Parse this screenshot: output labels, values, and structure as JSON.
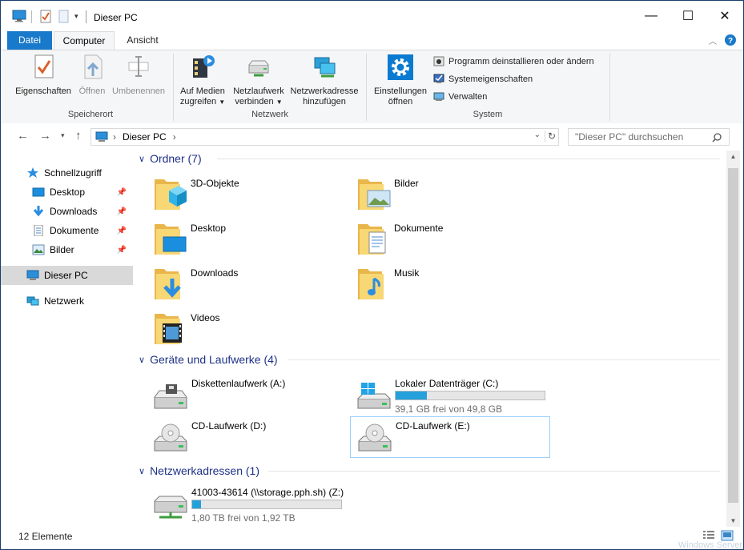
{
  "window": {
    "title": "Dieser PC"
  },
  "window_controls": {
    "minimize": "—",
    "maximize": "☐",
    "close": "✕"
  },
  "tabs": {
    "file": "Datei",
    "computer": "Computer",
    "view": "Ansicht"
  },
  "ribbon": {
    "properties": "Eigenschaften",
    "open": "Öffnen",
    "rename": "Umbenennen",
    "group_location": "Speicherort",
    "media_line1": "Auf Medien",
    "media_line2": "zugreifen",
    "netdrive_line1": "Netzlaufwerk",
    "netdrive_line2": "verbinden",
    "netloc_line1": "Netzwerkadresse",
    "netloc_line2": "hinzufügen",
    "group_network": "Netzwerk",
    "settings_line1": "Einstellungen",
    "settings_line2": "öffnen",
    "uninstall": "Programm deinstallieren oder ändern",
    "sysprops": "Systemeigenschaften",
    "manage": "Verwalten",
    "group_system": "System"
  },
  "address": {
    "crumb": "Dieser PC",
    "sep1": "›",
    "sep2": "›"
  },
  "search": {
    "placeholder": "\"Dieser PC\" durchsuchen"
  },
  "nav": {
    "quick_access": "Schnellzugriff",
    "desktop": "Desktop",
    "downloads": "Downloads",
    "documents": "Dokumente",
    "pictures": "Bilder",
    "this_pc": "Dieser PC",
    "network": "Netzwerk"
  },
  "groups": {
    "folders": "Ordner (7)",
    "devices": "Geräte und Laufwerke (4)",
    "netlocs": "Netzwerkadressen (1)"
  },
  "folders": [
    "3D-Objekte",
    "Bilder",
    "Desktop",
    "Dokumente",
    "Downloads",
    "Musik",
    "Videos"
  ],
  "drives": {
    "floppy": "Diskettenlaufwerk (A:)",
    "local": {
      "name": "Lokaler Datenträger (C:)",
      "free": "39,1 GB frei von 49,8 GB",
      "used_fraction": 0.21
    },
    "cd_d": "CD-Laufwerk (D:)",
    "cd_e": "CD-Laufwerk (E:)"
  },
  "netdrive": {
    "name": "41003-43614 (\\\\storage.pph.sh) (Z:)",
    "free": "1,80 TB frei von 1,92 TB",
    "used_fraction": 0.06
  },
  "status": {
    "count": "12 Elemente"
  },
  "desktop_text": "Windows Server",
  "colors": {
    "accent": "#1979ca",
    "group_header": "#1e3287",
    "bar_fill": "#26a0da",
    "selection": "#cce4f7"
  }
}
